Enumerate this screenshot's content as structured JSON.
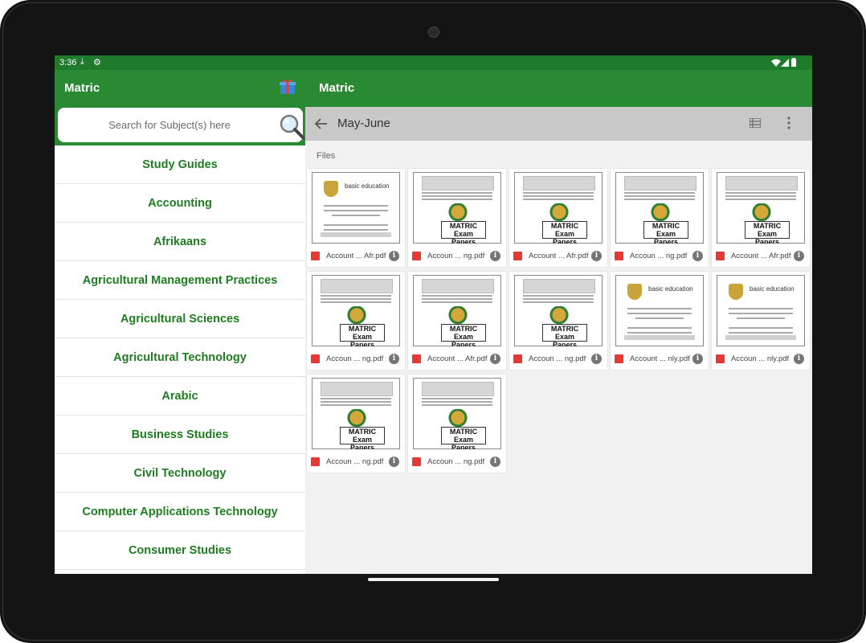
{
  "status": {
    "time": "3:36"
  },
  "app": {
    "title_left": "Matric",
    "title_right": "Matric"
  },
  "search": {
    "placeholder": "Search for Subject(s) here"
  },
  "subjects": [
    "Study Guides",
    "Accounting",
    "Afrikaans",
    "Agricultural Management Practices",
    "Agricultural Sciences",
    "Agricultural Technology",
    "Arabic",
    "Business Studies",
    "Civil Technology",
    "Computer Applications Technology",
    "Consumer Studies"
  ],
  "browser": {
    "folder": "May-June",
    "section_label": "Files",
    "files": [
      {
        "name": "Account ... Afr.pdf",
        "thumb": "logo"
      },
      {
        "name": "Accoun ... ng.pdf",
        "thumb": "matric"
      },
      {
        "name": "Account ... Afr.pdf",
        "thumb": "matric"
      },
      {
        "name": "Accoun ... ng.pdf",
        "thumb": "matric"
      },
      {
        "name": "Account ... Afr.pdf",
        "thumb": "matric"
      },
      {
        "name": "Accoun ... ng.pdf",
        "thumb": "matric"
      },
      {
        "name": "Account ... Afr.pdf",
        "thumb": "matric"
      },
      {
        "name": "Accoun ... ng.pdf",
        "thumb": "matric"
      },
      {
        "name": "Account ... nly.pdf",
        "thumb": "logo"
      },
      {
        "name": "Accoun ... nly.pdf",
        "thumb": "logo"
      },
      {
        "name": "Accoun ... ng.pdf",
        "thumb": "matric"
      },
      {
        "name": "Accoun ... ng.pdf",
        "thumb": "matric"
      }
    ]
  },
  "thumb_text": {
    "basic_education": "basic education",
    "matric_badge": "MATRIC Exam Papers"
  },
  "icons": {
    "gift": "gift-icon",
    "search": "magnifier-icon",
    "back": "arrow-back-icon",
    "list_view": "list-view-icon",
    "more": "more-vert-icon",
    "pdf": "pdf-icon",
    "info": "info-icon"
  },
  "colors": {
    "primary": "#2a8a33",
    "status_bar": "#1f7a2c",
    "subject_text": "#1e7d1e",
    "toolbar": "#c8c8c8"
  }
}
